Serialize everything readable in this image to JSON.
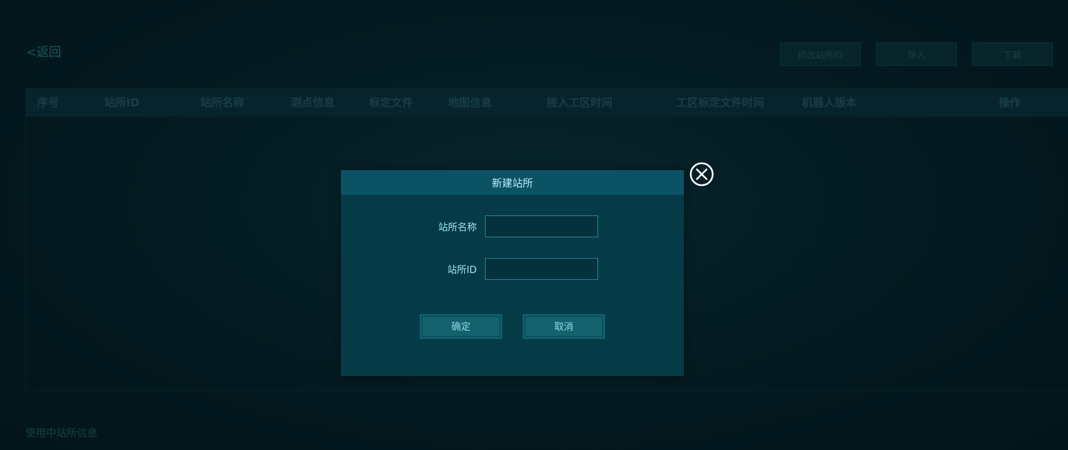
{
  "header": {
    "back_label": "<返回",
    "buttons": [
      {
        "label": "修改站所ID"
      },
      {
        "label": "导入"
      },
      {
        "label": "下载"
      }
    ]
  },
  "table": {
    "columns": [
      "序号",
      "站所ID",
      "站所名称",
      "测点信息",
      "标定文件",
      "地图信息",
      "接入工区时间",
      "工区标定文件时间",
      "机器人版本",
      "操作"
    ],
    "rows": []
  },
  "footer": {
    "text": "使用中站所信息"
  },
  "dialog": {
    "title": "新建站所",
    "fields": [
      {
        "label": "站所名称",
        "value": ""
      },
      {
        "label": "站所ID",
        "value": ""
      }
    ],
    "confirm_label": "确定",
    "cancel_label": "取消"
  },
  "colors": {
    "background": "#082731",
    "dialog": "#053b47",
    "dialog_header": "#0b5264",
    "accent_text": "#9fe6f5"
  }
}
